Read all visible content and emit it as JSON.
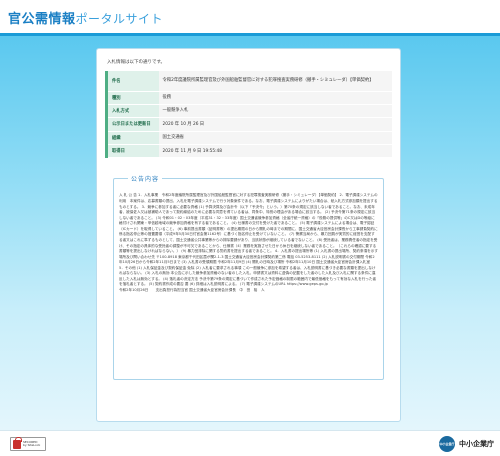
{
  "header": {
    "logo_main": "官公需情報",
    "logo_sub": "ポータルサイト"
  },
  "card": {
    "intro": "入札情報は以下の通りです。",
    "rows": [
      {
        "key": "件名",
        "value": "令和2年度議院所属監理官及び外国船舶監督官に対する犯罪搜査実務研修（撤手・シミュレーダ）【単価契約】"
      },
      {
        "key": "種別",
        "value": "役務"
      },
      {
        "key": "入札方式",
        "value": "一般競争入札"
      },
      {
        "key": "公示日または更新日",
        "value": "2020 年 10 月 26 日"
      },
      {
        "key": "組織",
        "value": "国土交通省"
      },
      {
        "key": "取得日",
        "value": "2020 年 11 月 9 日 19:55:48"
      }
    ]
  },
  "notice": {
    "title": "公告内容",
    "paragraphs": [
      "入 札 公 告 1．入札事業　令和2年度議院所属監理官及び外国船舶監督官に対する犯罪搜査実務研修（撤手・シミュレーダ）【単価契約】 2．電子調達システムの利用　本案件は、応募書類の提出、入札を電子調達システムで行う対象案件である。なお、電子調達システムによりがたい場合は、紙入札方式参加願を提出するものとする。 3．競争に参加する者に必要な資格 (1) 予算決算及び会計令（以下「予決令」という。）第70条の規定に該当しない者であること。なお、未成年者、被保佐人又は被補助人であって契約締結のために必要な同意を得ている者は、同条中、特別の理由がある場合に該当する。 (2) 予決令第71条の規定に該当しない者であること。 (3) 令和01・02・03年度（平成31・32・33年度）国土交通省競争参加資格（全省庁統一資格）の「役務の提供等」のC又はDの等級に格付けされ関東・甲信越地域の競争参加資格を有する者であること。 (4) 仕様書の交付を受けた者であること。 (5) 電子調達システムによる場合は、電子認証（ICカード）を取得していること。 (6) 事前提出書類（証明書等）の提出期限の日から開札の時までの期間に、国土交通省大臣官房会計課長から工事請負契約に係る指名停止等の措置要領（平成9年5月30日付官会第1162号）に基づく指名停止を受けていないこと。 (7) 警察当局から、暴力団員が実質的に経営を支配する者又はこれに準ずるものとして、国土交通省公共事業等からの排除要請があり、当該状態が継続している者でないこと。 (8) 受託者は、業務責任者の指定を受け、その指定の具体的な受託者の調整が不可欠であることから、仕様書（4）業務を実施させた日から休日を継続しない者であること。（これらの確認に要する書類等を提出しなければならない。） (9) 暴力団排除に関する誓約書を提出する者であること。 4．入札書の提出場所等 (1) 入札書の提出場所、契約条項を示す場所及び問い合わせ先 〒100-8918 東京都千代田区霞が関2-1-3 国土交通省大臣官房会計課契約第二係 電話 03-5253-8111 (2) 入札説明書の交付期間 令和2年10月26日から令和2年11月5日まで (3) 入札書の受領期限 令和2年11月9日 (4) 開札の日時及び場所 令和2年11月10日 国土交通省大臣官房会計課入札室",
      "5．その他 (1) 入札保証金及び契約保証金 免除 (2) 入札者に要求される事項 この一般競争に参加を希望する者は、入札説明書に基づき必要な書類を提出しなければならない。 (3) 入札の無効 本公告に示した競争参加資格のない者のした入札、申請書又は資料に虚偽の記載をした者のした入札及び入札に関する条件に違反した入札は無効とする。 (4) 落札者の決定方法 予決令第79条の規定に基づいて作成された予定価格の制限の範囲内で最低価格をもって有効な入札を行った者を落札者とする。 (5) 契約書作成の要否 要 (6) 詳細は入札説明書による。 (7) 電子調達システムのURL https://www.geps.go.jp",
      "令和2年10月26日　　支出負担行為担当官 国土交通省大臣官房会計課長　中　田　裕　人"
    ]
  },
  "footer": {
    "seal_line1": "SECURED",
    "seal_line2": "by SiteLock",
    "org_mark": "中小企業庁",
    "org_name": "中小企業庁"
  }
}
